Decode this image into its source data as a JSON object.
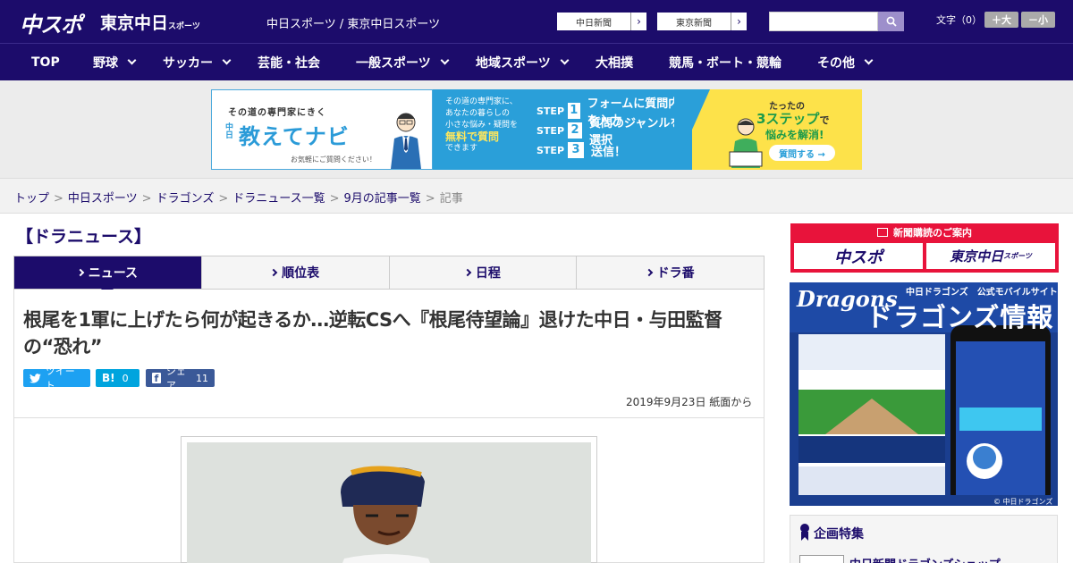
{
  "header": {
    "logo_main": "中スポ",
    "logo_tokyo": "東京中日",
    "logo_tokyo_sub": "スポーツ",
    "site_title": "中日スポーツ / 東京中日スポーツ",
    "link_chunichi": "中日新聞",
    "link_tokyo": "東京新聞",
    "search_placeholder": "",
    "font_size_label": "文字（0）",
    "font_bigger": "＋大",
    "font_smaller": "－小"
  },
  "nav": {
    "items": [
      {
        "label": "TOP",
        "dropdown": false
      },
      {
        "label": "野球",
        "dropdown": true
      },
      {
        "label": "サッカー",
        "dropdown": true
      },
      {
        "label": "芸能・社会",
        "dropdown": false
      },
      {
        "label": "一般スポーツ",
        "dropdown": true
      },
      {
        "label": "地域スポーツ",
        "dropdown": true
      },
      {
        "label": "大相撲",
        "dropdown": false
      },
      {
        "label": "競馬・ボート・競輪",
        "dropdown": false
      },
      {
        "label": "その他",
        "dropdown": true
      }
    ]
  },
  "banner": {
    "tag": "その道の専門家にきく",
    "small_v": "中日",
    "title": "教えてナビ",
    "footnote": "お気軽にご質問ください！",
    "mid_line1": "その道の専門家に、",
    "mid_line2": "あなたの暮らしの",
    "mid_line3": "小さな悩み・疑問を",
    "mid_highlight": "無料で質問",
    "mid_line4": "できます",
    "steps": [
      {
        "label": "STEP",
        "num": "1",
        "text": "フォームに質問内容を入力"
      },
      {
        "label": "STEP",
        "num": "2",
        "text": "質問のジャンルを選択"
      },
      {
        "label": "STEP",
        "num": "3",
        "text": "送信！"
      }
    ],
    "right_t1": "たったの",
    "right_t2": "3ステップ",
    "right_t2b": "で",
    "right_t3": "悩みを解消!",
    "right_btn": "質問する →"
  },
  "breadcrumb": {
    "items": [
      "トップ",
      "中日スポーツ",
      "ドラゴンズ",
      "ドラニュース一覧",
      "9月の記事一覧"
    ],
    "current": "記事",
    "sep": ">"
  },
  "section": {
    "title": "【ドラニュース】"
  },
  "tabs": [
    {
      "label": "ニュース",
      "active": true
    },
    {
      "label": "順位表",
      "active": false
    },
    {
      "label": "日程",
      "active": false
    },
    {
      "label": "ドラ番",
      "active": false
    }
  ],
  "article": {
    "headline": "根尾を1軍に上げたら何が起きるか…逆転CSへ『根尾待望論』退けた中日・与田監督の“恐れ”",
    "tweet_label": "ツイート",
    "hatena_label": "B!",
    "hatena_count": "0",
    "share_label": "シェア",
    "share_count": "11",
    "date": "2019年9月23日 紙面から"
  },
  "sidebar": {
    "subscribe_title": "新聞購読のご案内",
    "subscribe_chuspo": "中スポ",
    "subscribe_tokyo": "東京中日",
    "subscribe_tokyo_sub": "スポーツ",
    "dragons_brand": "Dragons",
    "dragons_sub": "中日ドラゴンズ　公式モバイルサイト",
    "dragons_title": "ドラゴンズ情報",
    "dragons_footer": "© 中日ドラゴンズ",
    "feature_title": "企画特集",
    "feature_item": "中日新聞ドラゴンズショップ"
  },
  "colors": {
    "brand_navy": "#1c0c6b",
    "twitter": "#1da1f2",
    "hatena": "#00a4de",
    "facebook": "#3b5998",
    "subscribe_red": "#e8133b"
  }
}
